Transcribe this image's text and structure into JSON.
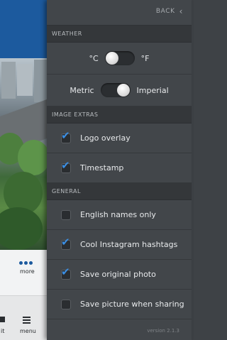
{
  "background_app": {
    "more_label": "more",
    "menu_label": "menu",
    "partial_label": "it"
  },
  "panel": {
    "back_label": "BACK",
    "sections": {
      "weather": "WEATHER",
      "image_extras": "IMAGE EXTRAS",
      "general": "GENERAL"
    },
    "temperature": {
      "left": "°C",
      "right": "°F",
      "selected": "°C"
    },
    "units": {
      "left": "Metric",
      "right": "Imperial",
      "selected": "Imperial"
    },
    "image_extras": [
      {
        "label": "Logo overlay",
        "checked": true
      },
      {
        "label": "Timestamp",
        "checked": true
      }
    ],
    "general": [
      {
        "label": "English names only",
        "checked": false
      },
      {
        "label": "Cool Instagram hashtags",
        "checked": true
      },
      {
        "label": "Save original photo",
        "checked": true
      },
      {
        "label": "Save picture when sharing",
        "checked": false
      }
    ],
    "version": "version 2.1.3"
  },
  "colors": {
    "accent": "#3b8ee3",
    "panel_bg": "#42464a",
    "section_bg": "#34373a"
  }
}
